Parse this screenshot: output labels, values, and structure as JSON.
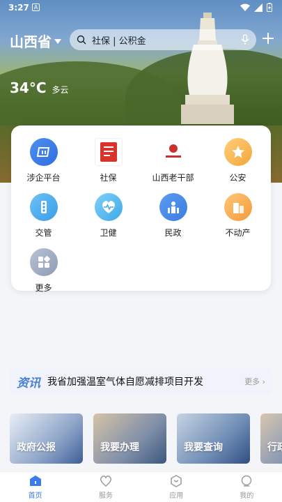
{
  "status_bar": {
    "time": "3:27",
    "a_badge": "A"
  },
  "header": {
    "province": "山西省",
    "search_placeholder": "社保 | 公积金",
    "weather": {
      "temperature": "34°C",
      "condition": "多云"
    }
  },
  "services": [
    {
      "label": "涉企平台",
      "icon": "enterprise-platform-icon"
    },
    {
      "label": "社保",
      "icon": "social-security-icon"
    },
    {
      "label": "山西老干部",
      "icon": "veteran-cadre-icon"
    },
    {
      "label": "公安",
      "icon": "police-icon"
    },
    {
      "label": "交管",
      "icon": "traffic-icon"
    },
    {
      "label": "卫健",
      "icon": "health-icon"
    },
    {
      "label": "民政",
      "icon": "civil-affairs-icon"
    },
    {
      "label": "不动产",
      "icon": "real-estate-icon"
    },
    {
      "label": "更多",
      "icon": "more-icon"
    }
  ],
  "news": {
    "tag": "资讯",
    "headline": "我省加强温室气体自愿减排项目开发",
    "more": "更多"
  },
  "tiles": [
    {
      "label": "政府公报"
    },
    {
      "label": "我要办理"
    },
    {
      "label": "我要查询"
    },
    {
      "label": "行政"
    }
  ],
  "tabbar": [
    {
      "label": "首页",
      "icon": "home-icon",
      "active": true
    },
    {
      "label": "服务",
      "icon": "heart-icon",
      "active": false
    },
    {
      "label": "应用",
      "icon": "app-hexagon-icon",
      "active": false
    },
    {
      "label": "我的",
      "icon": "user-circle-icon",
      "active": false
    }
  ],
  "colors": {
    "accent": "#3b7bea",
    "news_tag": "#4a7fd6"
  }
}
